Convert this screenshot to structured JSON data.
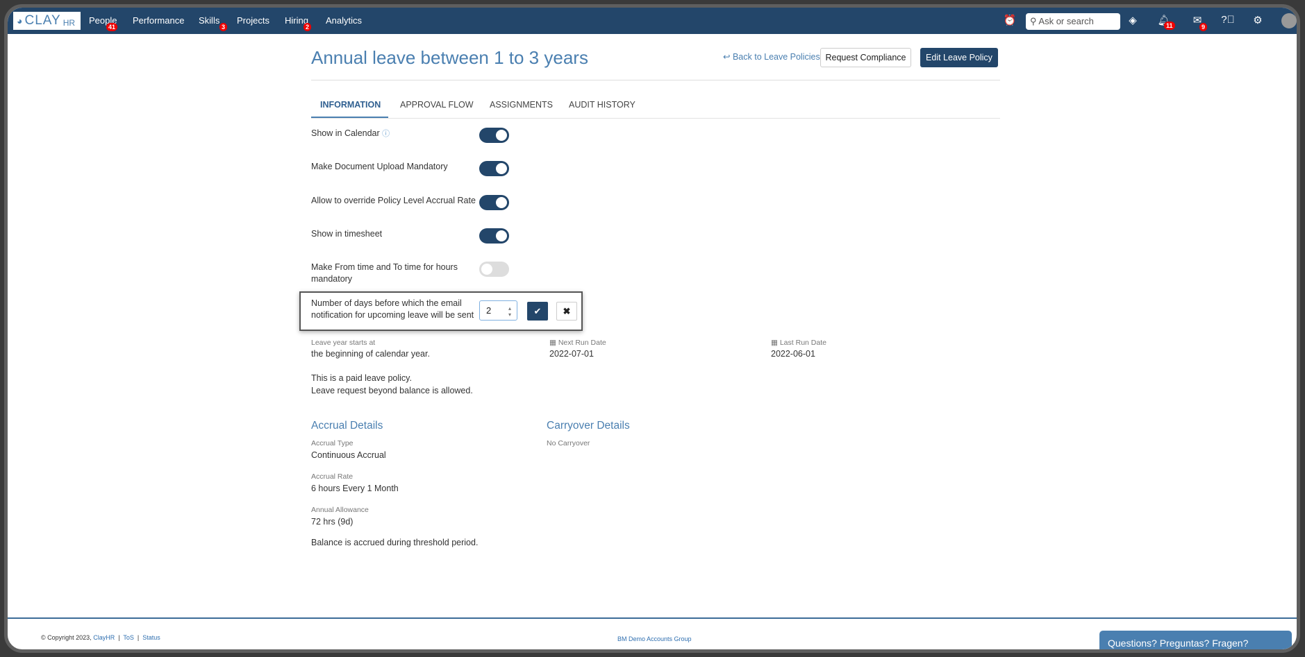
{
  "nav": {
    "logo": "CLAY",
    "logo_suffix": "HR",
    "items": [
      {
        "label": "People",
        "badge": "41"
      },
      {
        "label": "Performance"
      },
      {
        "label": "Skills",
        "badge": "3"
      },
      {
        "label": "Projects"
      },
      {
        "label": "Hiring",
        "badge": "2"
      },
      {
        "label": "Analytics"
      }
    ],
    "search_placeholder": "Ask or search",
    "notifications_badge": "11",
    "messages_badge": "9"
  },
  "header": {
    "title": "Annual leave between 1 to 3 years",
    "back_link": "Back to Leave Policies",
    "request_compliance": "Request Compliance",
    "edit_policy": "Edit Leave Policy"
  },
  "tabs": [
    "INFORMATION",
    "APPROVAL FLOW",
    "ASSIGNMENTS",
    "AUDIT HISTORY"
  ],
  "active_tab": "INFORMATION",
  "settings": [
    {
      "label": "Show in Calendar",
      "on": true
    },
    {
      "label": "Make Document Upload Mandatory",
      "on": true
    },
    {
      "label": "Allow to override Policy Level Accrual Rate",
      "on": true
    },
    {
      "label": "Show in timesheet",
      "on": true
    },
    {
      "label": "Make From time and To time for hours mandatory",
      "on": false
    }
  ],
  "email_notice": {
    "label": "Number of days before which the email notification for upcoming leave will be sent",
    "value": "2"
  },
  "info": {
    "leave_year_label": "Leave year starts at",
    "leave_year_value": "the beginning of calendar year.",
    "next_run_label": "Next Run Date",
    "next_run_value": "2022-07-01",
    "last_run_label": "Last Run Date",
    "last_run_value": "2022-06-01",
    "paid": "This is a paid leave policy.",
    "beyond": "Leave request beyond balance is allowed."
  },
  "accrual": {
    "title": "Accrual Details",
    "type_label": "Accrual Type",
    "type_value": "Continuous Accrual",
    "rate_label": "Accrual Rate",
    "rate_value": "6 hours Every 1 Month",
    "allowance_label": "Annual Allowance",
    "allowance_value": "72 hrs (9d)",
    "note": "Balance is accrued during threshold period."
  },
  "carryover": {
    "title": "Carryover Details",
    "value": "No Carryover"
  },
  "footer": {
    "copyright": "© Copyright 2023,",
    "brand": "ClayHR",
    "tos": "ToS",
    "status": "Status",
    "group": "BM Demo Accounts Group",
    "chat": "Questions? Preguntas? Fragen?"
  },
  "colors": {
    "nav": "#23466a",
    "accent": "#4a7fb0",
    "badge": "#e00000"
  }
}
